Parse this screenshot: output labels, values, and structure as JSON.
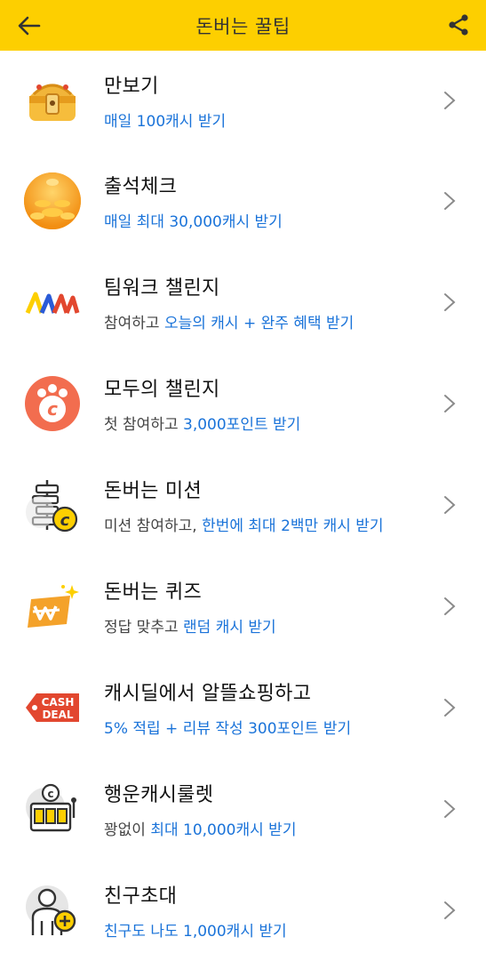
{
  "header": {
    "title": "돈버는 꿀팁"
  },
  "colors": {
    "header_bg": "#FDCF00",
    "link_blue": "#1a73d9",
    "chevron": "#8a8a8a"
  },
  "items": [
    {
      "title": "만보기",
      "sub_prefix": "",
      "sub": "매일 100캐시 받기",
      "icon": "treasure-chest-icon"
    },
    {
      "title": "출석체크",
      "sub_prefix": "",
      "sub": "매일 최대 30,000캐시 받기",
      "icon": "coin-pile-icon"
    },
    {
      "title": "팀워크 챌린지",
      "sub_prefix": "참여하고 ",
      "sub": "오늘의 캐시 + 완주 혜택 받기",
      "icon": "teamwork-logo-icon"
    },
    {
      "title": "모두의 챌린지",
      "sub_prefix": "첫 참여하고 ",
      "sub": "3,000포인트 받기",
      "icon": "paw-coin-icon"
    },
    {
      "title": "돈버는 미션",
      "sub_prefix": "미션 참여하고, ",
      "sub": "한번에 최대 2백만 캐시 받기",
      "icon": "mission-coin-icon"
    },
    {
      "title": "돈버는 퀴즈",
      "sub_prefix": "정답 맞추고 ",
      "sub": "랜덤 캐시 받기",
      "icon": "quiz-won-icon"
    },
    {
      "title": "캐시딜에서 알뜰쇼핑하고",
      "sub_prefix": "",
      "sub": "5% 적립 + 리뷰 작성 300포인트 받기",
      "icon": "cash-deal-tag-icon"
    },
    {
      "title": "행운캐시룰렛",
      "sub_prefix": "꽝없이 ",
      "sub": "최대 10,000캐시 받기",
      "icon": "slot-machine-icon"
    },
    {
      "title": "친구초대",
      "sub_prefix": "",
      "sub": "친구도 나도 1,000캐시 받기",
      "icon": "add-friend-icon"
    }
  ],
  "cash_deal_logo": {
    "line1": "CASH",
    "line2": "DEAL"
  }
}
